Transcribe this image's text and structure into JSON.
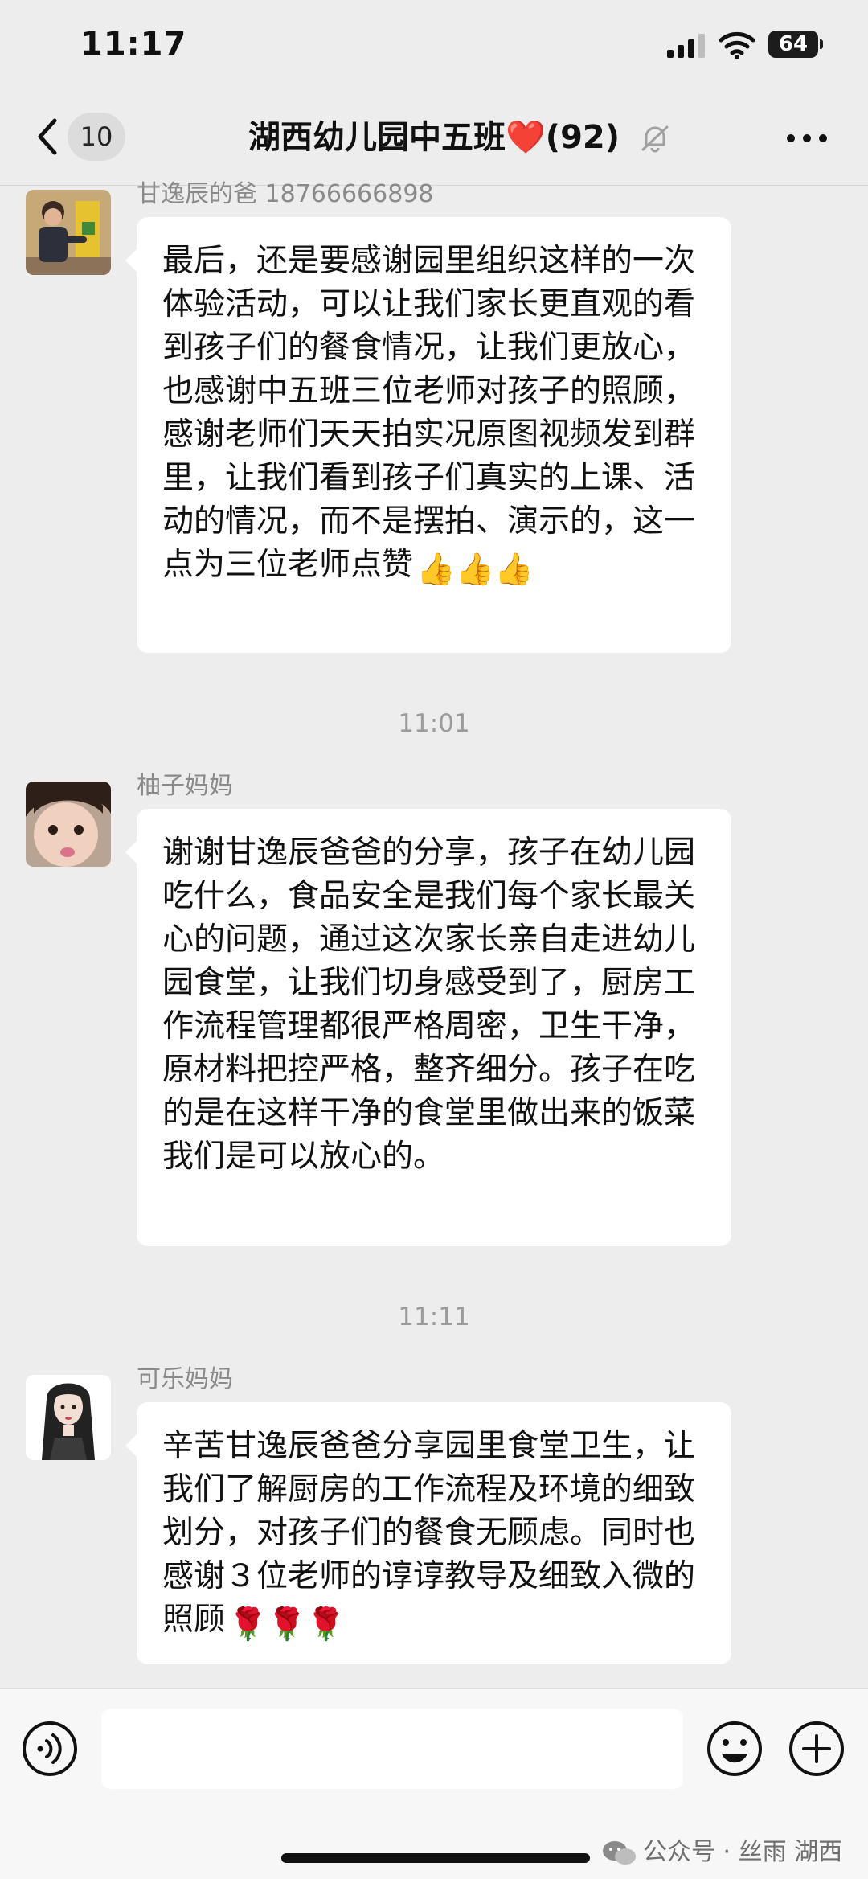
{
  "status_bar": {
    "time": "11:17",
    "battery": "64"
  },
  "nav": {
    "back_badge": "10",
    "title": "湖西幼儿园中五班❤️(92)"
  },
  "messages": [
    {
      "sender": "甘逸辰的爸 18766666898",
      "text": "最后，还是要感谢园里组织这样的一次体验活动，可以让我们家长更直观的看到孩子们的餐食情况，让我们更放心，也感谢中五班三位老师对孩子的照顾，感谢老师们天天拍实况原图视频发到群里，让我们看到孩子们真实的上课、活动的情况，而不是摆拍、演示的，这一点为三位老师点赞",
      "emoji": "👍👍👍"
    },
    {
      "time": "11:01",
      "sender": "柚子妈妈",
      "text": "谢谢甘逸辰爸爸的分享，孩子在幼儿园吃什么，食品安全是我们每个家长最关心的问题，通过这次家长亲自走进幼儿园食堂，让我们切身感受到了，厨房工作流程管理都很严格周密，卫生干净，原材料把控严格，整齐细分。孩子在吃的是在这样干净的食堂里做出来的饭菜我们是可以放心的。"
    },
    {
      "time": "11:11",
      "sender": "可乐妈妈",
      "text": "辛苦甘逸辰爸爸分享园里食堂卫生，让我们了解厨房的工作流程及环境的细致划分，对孩子们的餐食无顾虑。同时也感谢３位老师的谆谆教导及细致入微的照顾",
      "emoji": "🌹🌹🌹"
    }
  ],
  "input": {
    "placeholder": ""
  },
  "watermark": "公众号 · 丝雨 湖西",
  "icons": {
    "back": "chevron-left-icon",
    "mute": "bell-slash-icon",
    "more": "ellipsis-icon",
    "voice": "voice-icon",
    "emoji": "smiley-icon",
    "plus": "plus-icon"
  },
  "colors": {
    "background": "#ededed",
    "bubble": "#ffffff",
    "heart": "#e8263a"
  }
}
